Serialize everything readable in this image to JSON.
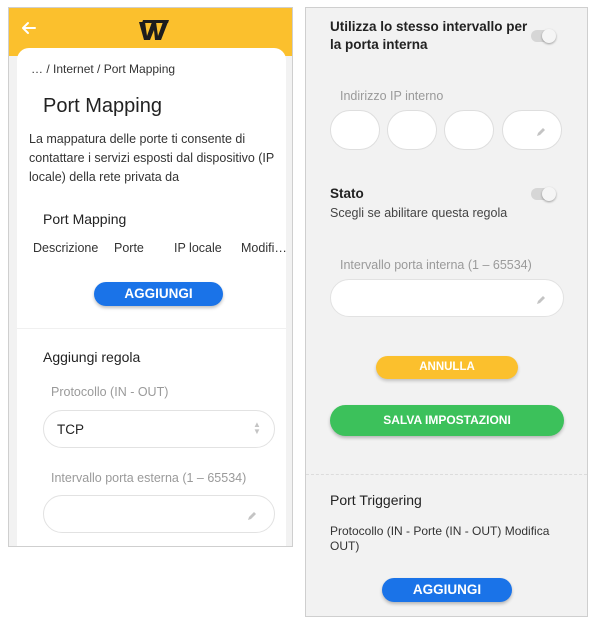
{
  "left": {
    "breadcrumb": "… / Internet / Port Mapping",
    "title": "Port Mapping",
    "description": "La mappatura delle porte ti consente di contattare i servizi esposti dal dispositivo (IP locale) della rete privata da",
    "section_title": "Port Mapping",
    "columns": [
      "Descrizione",
      "Porte",
      "IP locale",
      "Modifi…"
    ],
    "add_button": "AGGIUNGI",
    "add_rule_title": "Aggiungi regola",
    "protocol_label": "Protocollo (IN - OUT)",
    "protocol_value": "TCP",
    "ext_range_label": "Intervallo porta esterna (1 – 65534)",
    "ext_range_value": ""
  },
  "right": {
    "same_interval_label": "Utilizza lo stesso intervallo per la porta interna",
    "internal_ip_label": "Indirizzo IP interno",
    "state_title": "Stato",
    "state_subtitle": "Scegli se abilitare questa regola",
    "int_range_label": "Intervallo porta interna (1 – 65534)",
    "int_range_value": "",
    "cancel_button": "ANNULLA",
    "save_button": "SALVA IMPOSTAZIONI",
    "trigger_title": "Port Triggering",
    "trigger_columns": "Protocollo (IN - Porte (IN - OUT) Modifica OUT)",
    "add_button": "AGGIUNGI"
  },
  "toggles": {
    "same_interval_on": false,
    "state_on": false
  },
  "colors": {
    "header": "#fbc02d",
    "primary_button": "#1a73e8",
    "cancel_button": "#fbc02d",
    "save_button": "#3cc15b"
  },
  "icons": {
    "back": "arrow-left-icon",
    "logo": "brand-logo",
    "select": "updown-chevron-icon",
    "edit": "pencil-icon"
  }
}
